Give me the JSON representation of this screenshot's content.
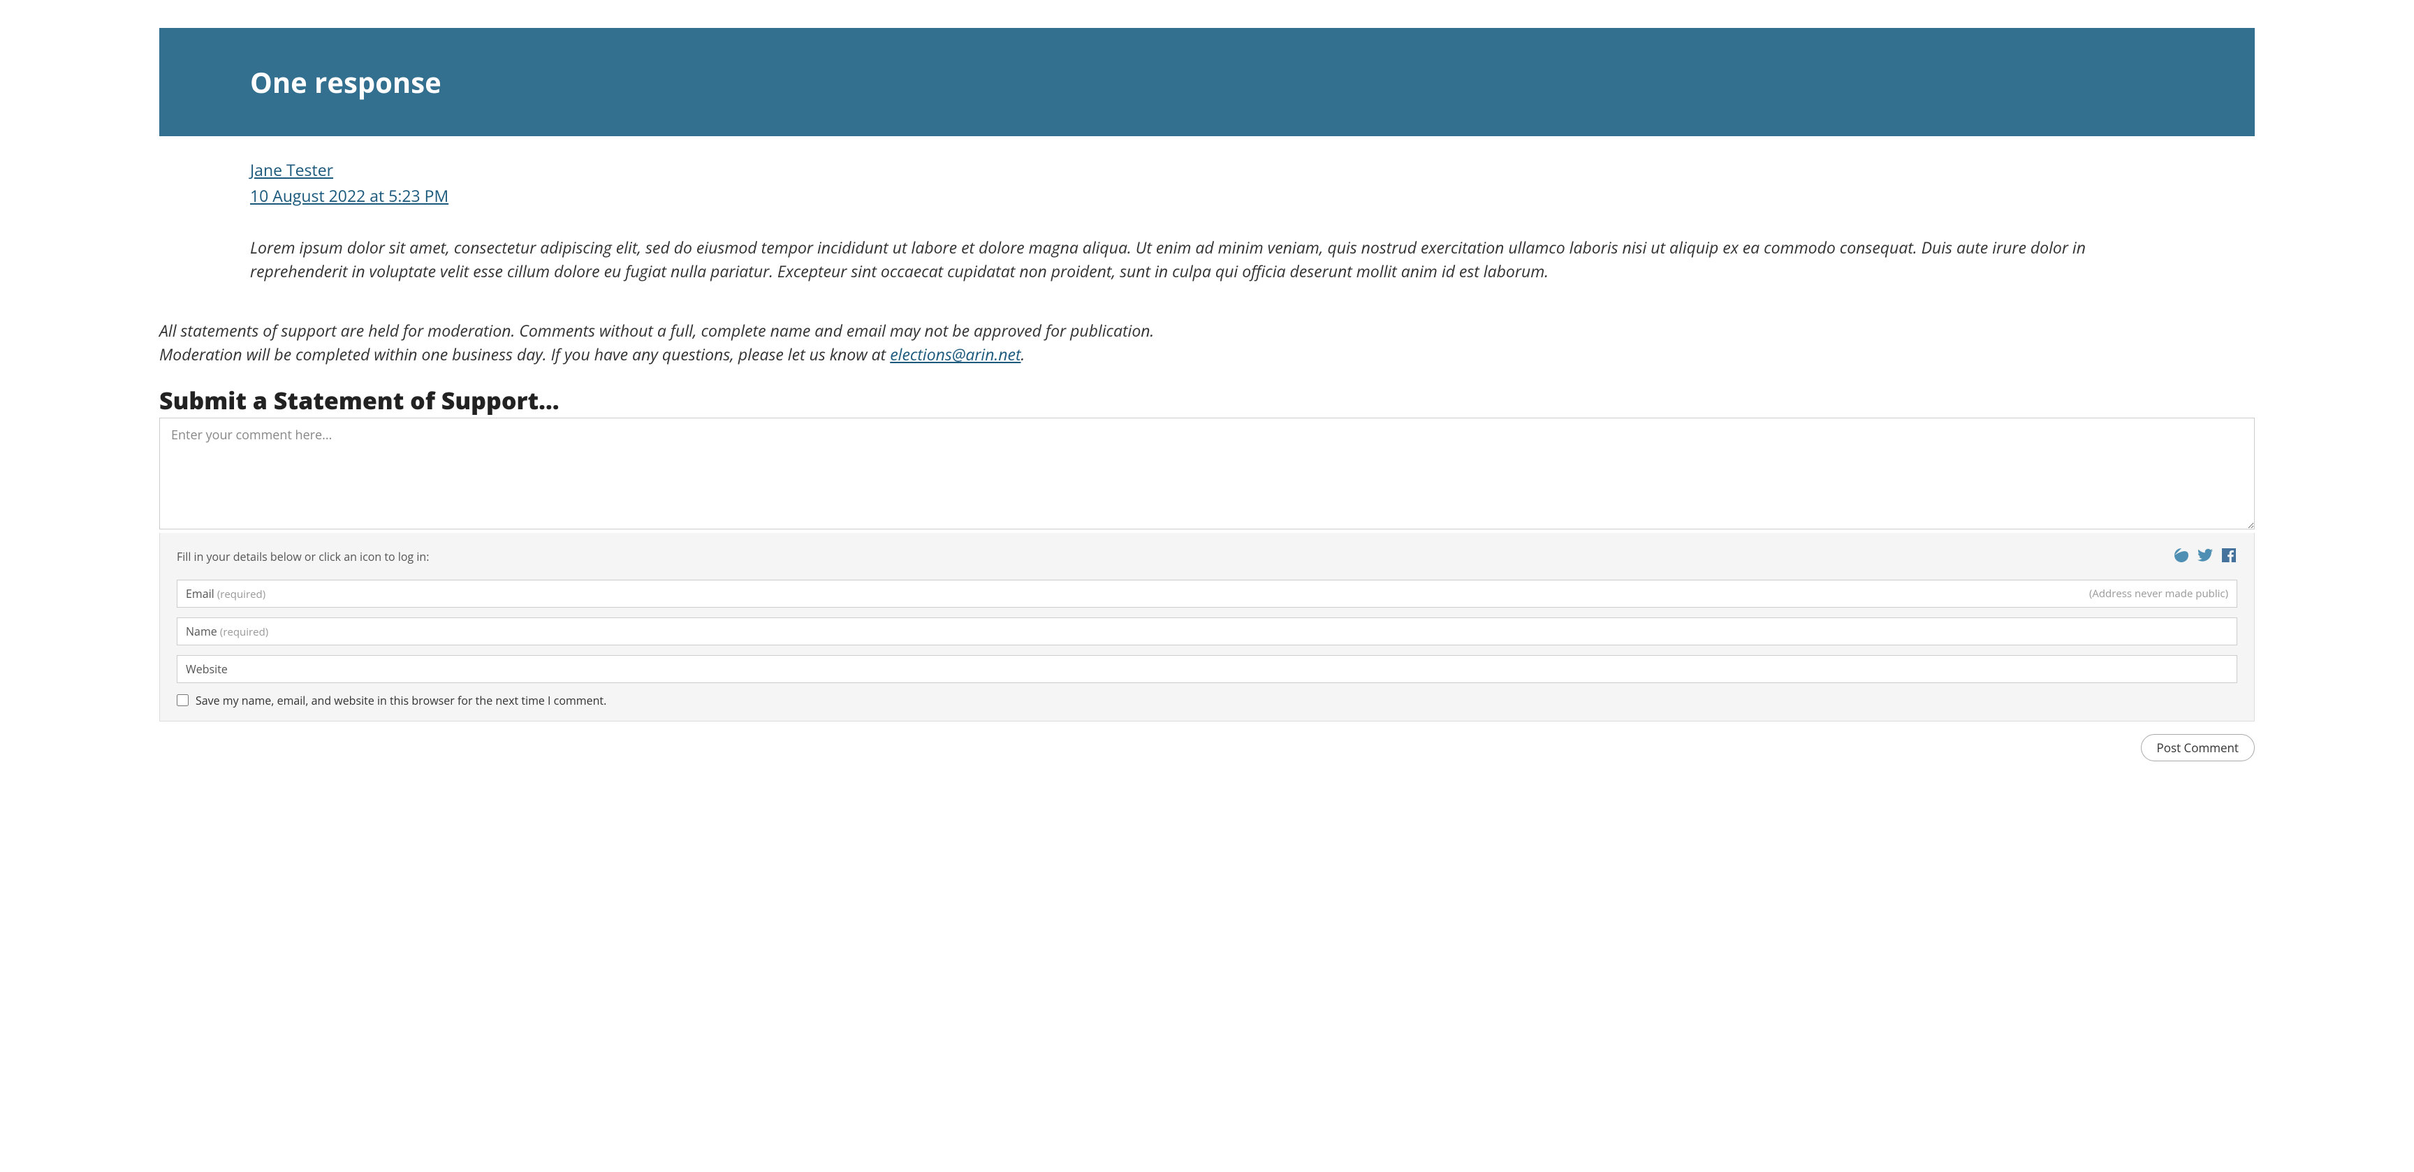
{
  "responses": {
    "heading": "One response",
    "comment": {
      "author": "Jane Tester",
      "timestamp": "10 August 2022 at 5:23 PM",
      "body": "Lorem ipsum dolor sit amet, consectetur adipiscing elit, sed do eiusmod tempor incididunt ut labore et dolore magna aliqua. Ut enim ad minim veniam, quis nostrud exercitation ullamco laboris nisi ut aliquip ex ea commodo consequat. Duis aute irure dolor in reprehenderit in voluptate velit esse cillum dolore eu fugiat nulla pariatur. Excepteur sint occaecat cupidatat non proident, sunt in culpa qui officia deserunt mollit anim id est laborum."
    }
  },
  "moderation": {
    "line1": "All statements of support are held for moderation. Comments without a full, complete name and email may not be approved for publication.",
    "line2_prefix": "Moderation will be completed within one business day. If you have any questions, please let us know at ",
    "email": "elections@arin.net",
    "line2_suffix": "."
  },
  "form": {
    "title": "Submit a Statement of Support…",
    "comment_placeholder": "Enter your comment here...",
    "details_label": "Fill in your details below or click an icon to log in:",
    "email_label": "Email",
    "required_text": "(required)",
    "email_note": "(Address never made public)",
    "name_label": "Name",
    "website_label": "Website",
    "save_info_label": "Save my name, email, and website in this browser for the next time I comment.",
    "submit_label": "Post Comment"
  }
}
